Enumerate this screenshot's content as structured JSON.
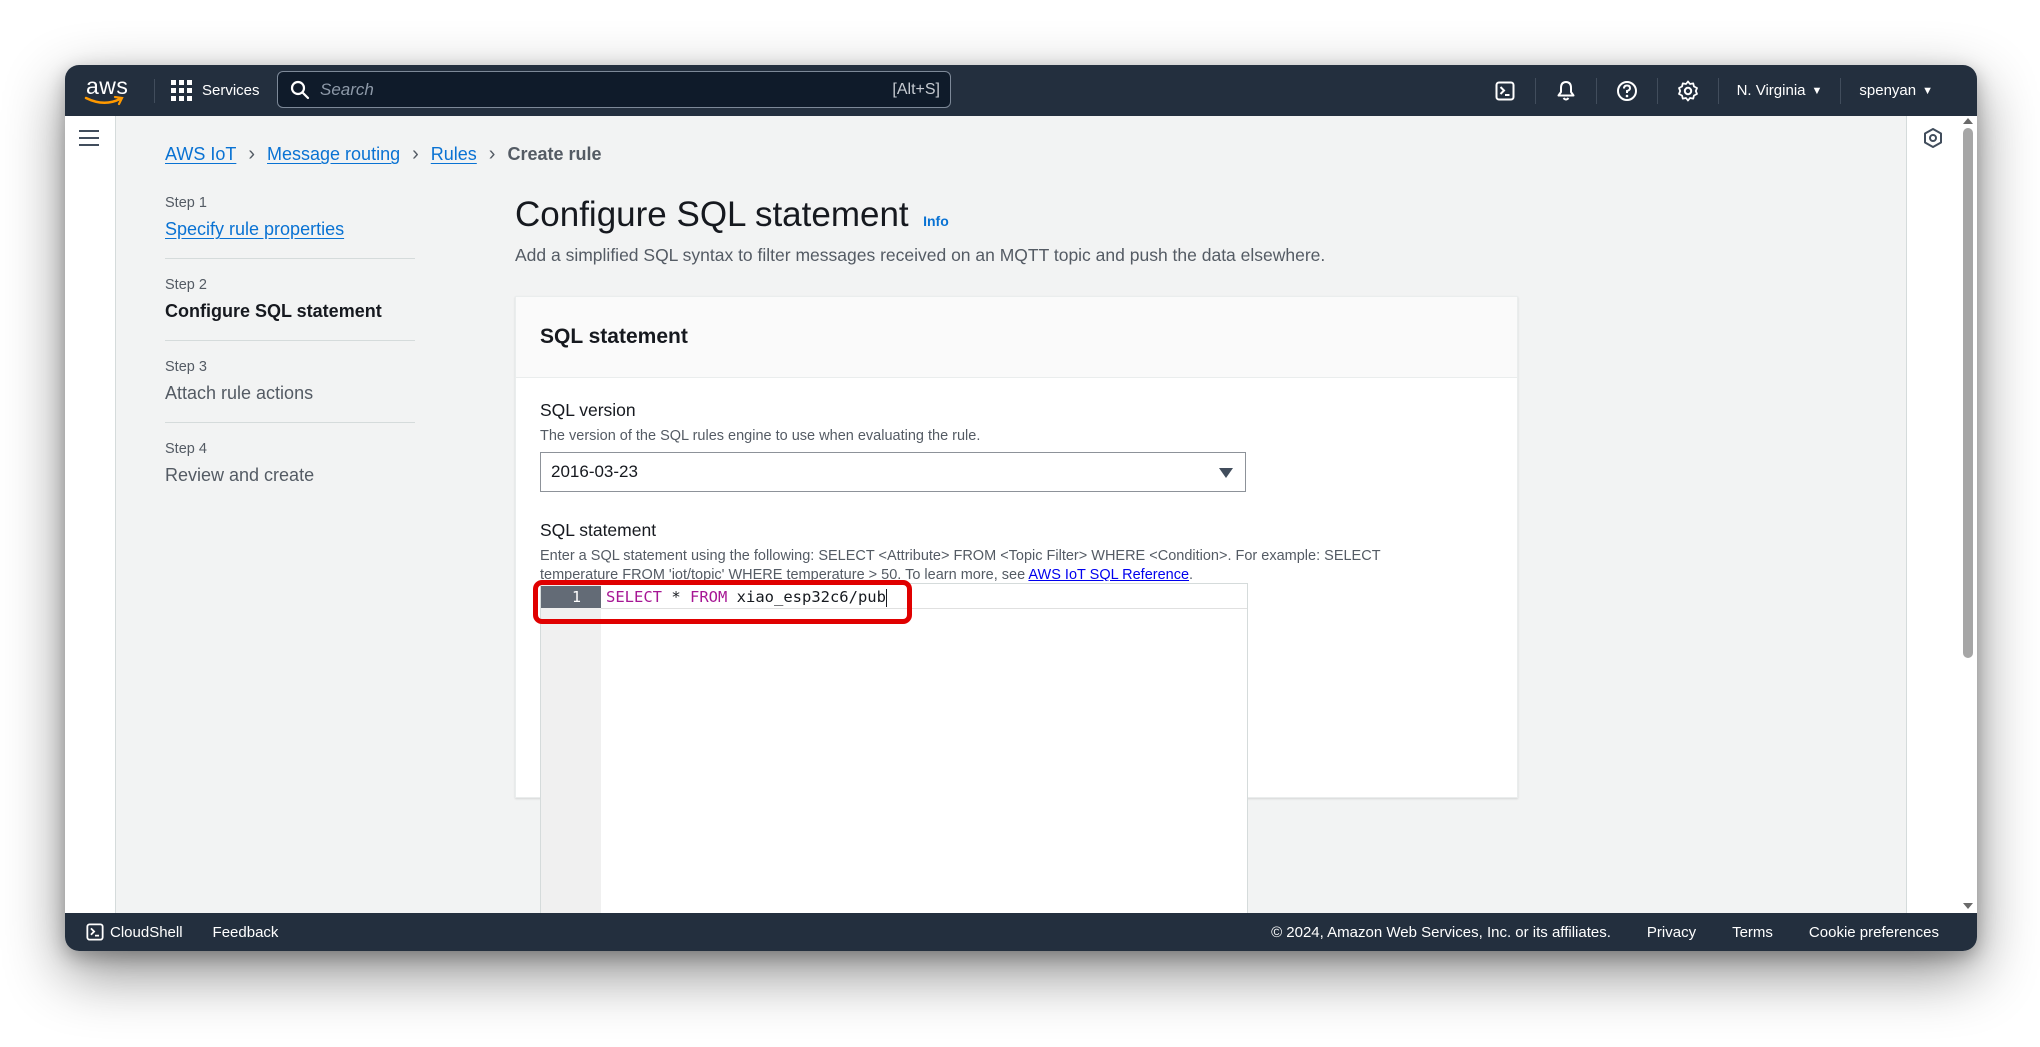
{
  "topnav": {
    "logo": "aws",
    "services_label": "Services",
    "search_placeholder": "Search",
    "search_shortcut": "[Alt+S]",
    "region": "N. Virginia",
    "user": "spenyan"
  },
  "breadcrumb": {
    "items": [
      "AWS IoT",
      "Message routing",
      "Rules"
    ],
    "current": "Create rule"
  },
  "steps": [
    {
      "number": "Step 1",
      "label": "Specify rule properties"
    },
    {
      "number": "Step 2",
      "label": "Configure SQL statement"
    },
    {
      "number": "Step 3",
      "label": "Attach rule actions"
    },
    {
      "number": "Step 4",
      "label": "Review and create"
    }
  ],
  "main": {
    "title": "Configure SQL statement",
    "info": "Info",
    "description": "Add a simplified SQL syntax to filter messages received on an MQTT topic and push the data elsewhere."
  },
  "panel": {
    "title": "SQL statement",
    "sql_version_label": "SQL version",
    "sql_version_desc": "The version of the SQL rules engine to use when evaluating the rule.",
    "sql_version_value": "2016-03-23",
    "sql_statement_label": "SQL statement",
    "sql_statement_desc": "Enter a SQL statement using the following: SELECT <Attribute> FROM <Topic Filter> WHERE <Condition>. For example: SELECT temperature FROM 'iot/topic' WHERE temperature > 50. To learn more, see ",
    "sql_reference_link": "AWS IoT SQL Reference",
    "sql_desc_end": ".",
    "editor": {
      "line_number": "1",
      "kw_select": "SELECT",
      "star": " * ",
      "kw_from": "FROM",
      "topic": " xiao_esp32c6/pub"
    }
  },
  "footer": {
    "cloudshell": "CloudShell",
    "feedback": "Feedback",
    "copyright": "© 2024, Amazon Web Services, Inc. or its affiliates.",
    "privacy": "Privacy",
    "terms": "Terms",
    "cookie": "Cookie preferences"
  },
  "colors": {
    "nav_bg": "#232f3e",
    "link": "#0972d3",
    "highlight": "#e00000"
  }
}
